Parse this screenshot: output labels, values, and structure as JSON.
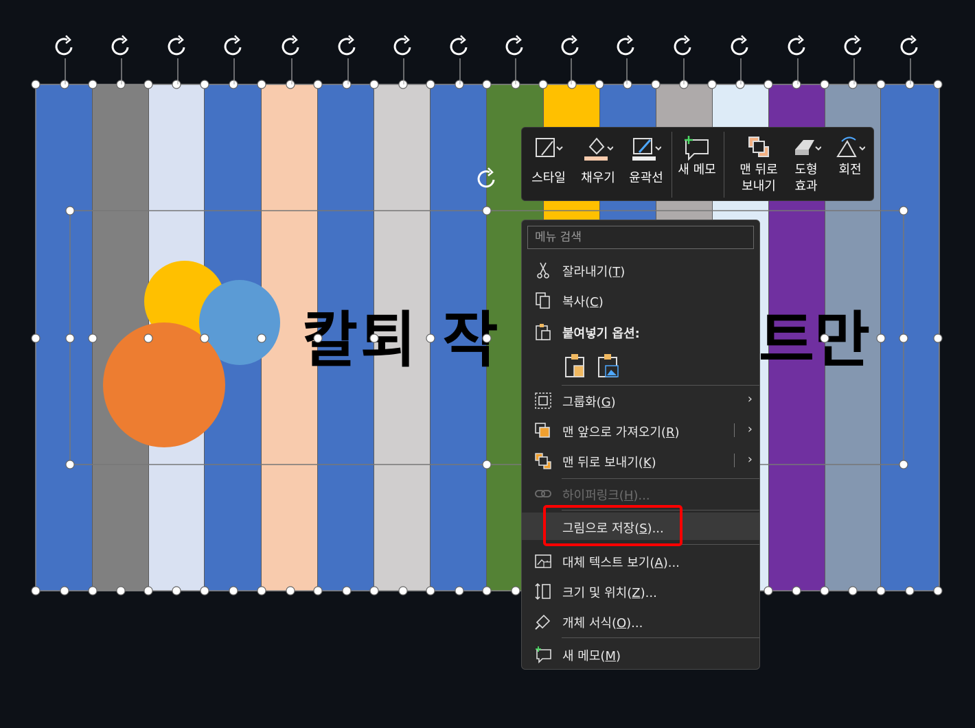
{
  "slide": {
    "title_part1": "칼퇴 작",
    "title_part2": "트만",
    "stripe_colors": [
      "#4472c4",
      "#808080",
      "#d9e1f2",
      "#4472c4",
      "#f8cbad",
      "#4472c4",
      "#d0cece",
      "#4472c4",
      "#548235",
      "#ffc000",
      "#4472c4",
      "#aeaaaa",
      "#ddebf7",
      "#7030a0",
      "#8497b0",
      "#4472c4"
    ],
    "circle_colors": {
      "yellow": "#ffc000",
      "blue": "#5b9bd5",
      "orange": "#ed7d31"
    }
  },
  "toolbar": {
    "style": "스타일",
    "fill": "채우기",
    "outline": "윤곽선",
    "new_comment": "새 메모",
    "send_back_line1": "맨 뒤로",
    "send_back_line2": "보내기",
    "effects_line1": "도형",
    "effects_line2": "효과",
    "rotate": "회전"
  },
  "menu": {
    "search_placeholder": "메뉴 검색",
    "cut": "잘라내기(",
    "cut_key": "T",
    "copy": "복사(",
    "copy_key": "C",
    "paste_options": "붙여넣기 옵션:",
    "group": "그룹화(",
    "group_key": "G",
    "bring_front": "맨 앞으로 가져오기(",
    "bring_front_key": "R",
    "send_back": "맨 뒤로 보내기(",
    "send_back_key": "K",
    "hyperlink": "하이퍼링크(",
    "hyperlink_key": "H",
    "save_as_picture": "그림으로 저장(",
    "save_as_picture_key": "S",
    "alt_text": "대체 텍스트 보기(",
    "alt_text_key": "A",
    "size_position": "크기 및 위치(",
    "size_position_key": "Z",
    "format_object": "개체 서식(",
    "format_object_key": "O",
    "new_comment": "새 메모(",
    "new_comment_key": "M",
    "close_paren": ")",
    "ellipsis_paren": ")...",
    "arrow": "›"
  }
}
